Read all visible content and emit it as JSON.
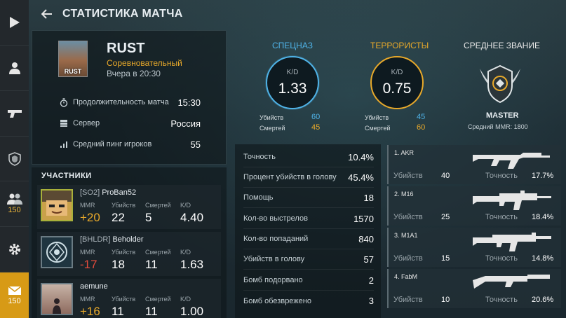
{
  "header": {
    "title": "Статистика матча"
  },
  "nav": {
    "friends_badge": "150",
    "mail_badge": "150"
  },
  "map": {
    "thumb_label": "RUST",
    "name": "RUST",
    "mode": "Соревновательный",
    "time": "Вчера в 20:30",
    "duration_label": "Продолжительность матча",
    "duration_value": "15:30",
    "server_label": "Сервер",
    "server_value": "Россия",
    "ping_label": "Средний пинг игроков",
    "ping_value": "55"
  },
  "participants": {
    "heading": "УЧАСТНИКИ",
    "col_mmr": "MMR",
    "col_kills": "Убийств",
    "col_deaths": "Смертей",
    "col_kd": "K/D",
    "players": [
      {
        "tag": "[SO2]",
        "name": "ProBan52",
        "mmr": "+20",
        "kills": "22",
        "deaths": "5",
        "kd": "4.40"
      },
      {
        "tag": "[BHLDR]",
        "name": "Beholder",
        "mmr": "-17",
        "kills": "18",
        "deaths": "11",
        "kd": "1.63"
      },
      {
        "tag": "",
        "name": "aemune",
        "mmr": "+16",
        "kills": "11",
        "deaths": "11",
        "kd": "1.00"
      }
    ]
  },
  "teams": {
    "ct": {
      "title": "СПЕЦНАЗ",
      "kd_label": "K/D",
      "kd": "1.33",
      "kills_label": "Убийств",
      "kills": "60",
      "deaths_label": "Смертей",
      "deaths": "45"
    },
    "t": {
      "title": "ТЕРРОРИСТЫ",
      "kd_label": "K/D",
      "kd": "0.75",
      "kills_label": "Убийств",
      "kills": "45",
      "deaths_label": "Смертей",
      "deaths": "60"
    },
    "rank": {
      "title": "СРЕДНЕЕ ЗВАНИЕ",
      "name": "MASTER",
      "mmr": "Средний MMR: 1800"
    }
  },
  "stats": [
    {
      "label": "Точность",
      "value": "10.4%"
    },
    {
      "label": "Процент убийств в голову",
      "value": "45.4%"
    },
    {
      "label": "Помощь",
      "value": "18"
    },
    {
      "label": "Кол-во выстрелов",
      "value": "1570"
    },
    {
      "label": "Кол-во попаданий",
      "value": "840"
    },
    {
      "label": "Убийств в голову",
      "value": "57"
    },
    {
      "label": "Бомб подорвано",
      "value": "2"
    },
    {
      "label": "Бомб обезврежено",
      "value": "3"
    }
  ],
  "weapons": {
    "kills_label": "Убийств",
    "acc_label": "Точность",
    "items": [
      {
        "name": "1. AKR",
        "kills": "40",
        "accuracy": "17.7%"
      },
      {
        "name": "2. M16",
        "kills": "25",
        "accuracy": "18.4%"
      },
      {
        "name": "3. M1A1",
        "kills": "15",
        "accuracy": "14.8%"
      },
      {
        "name": "4. FabM",
        "kills": "10",
        "accuracy": "20.6%"
      }
    ]
  }
}
